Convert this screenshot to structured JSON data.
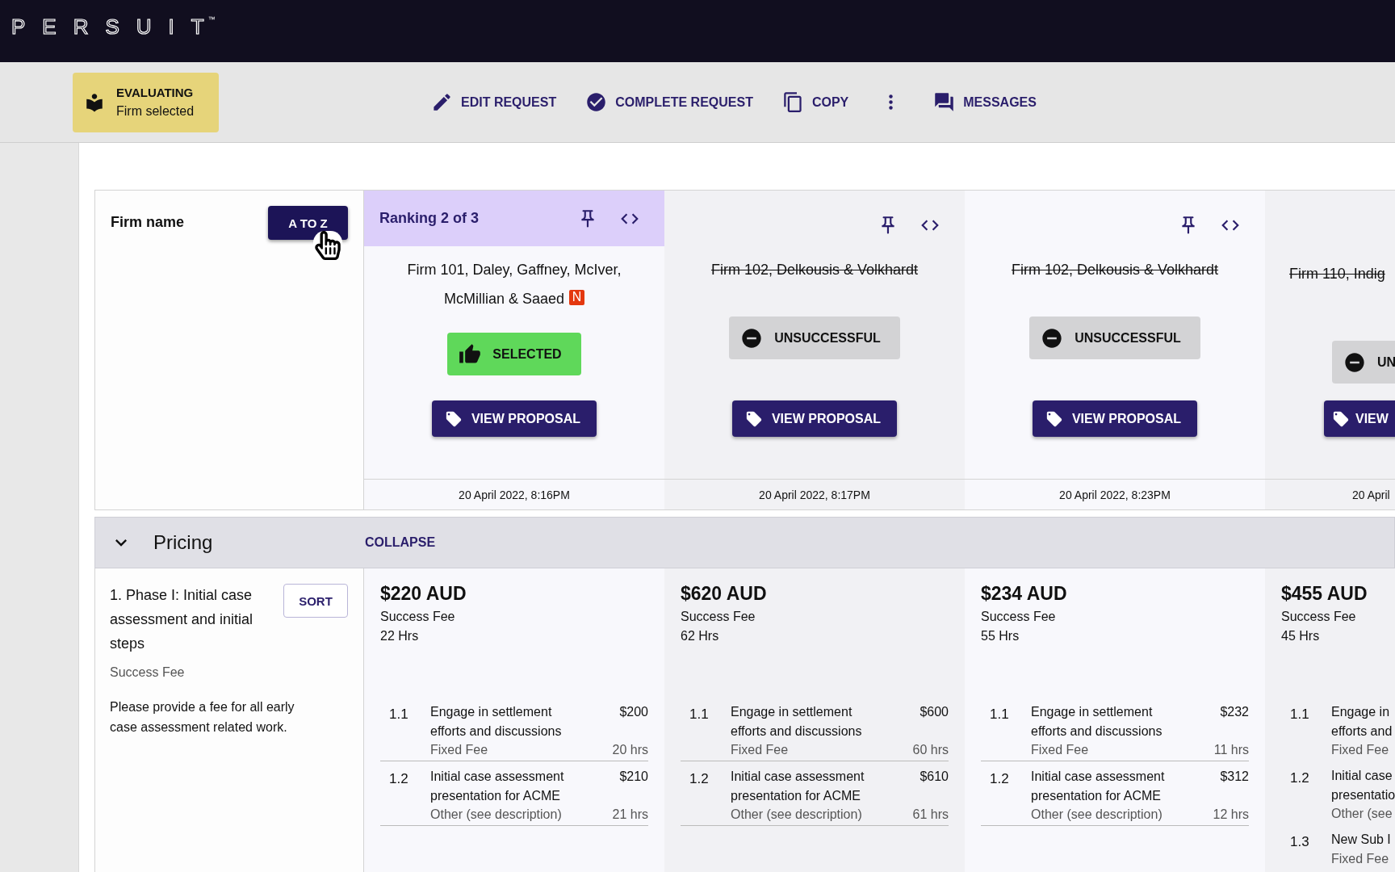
{
  "brand": {
    "logo": "PERSUIT",
    "trademark": "™"
  },
  "status": {
    "title": "EVALUATING",
    "subtitle": "Firm selected"
  },
  "actions": [
    {
      "kind": "edit",
      "label": "EDIT REQUEST"
    },
    {
      "kind": "complete",
      "label": "COMPLETE REQUEST"
    },
    {
      "kind": "copy",
      "label": "COPY"
    },
    {
      "kind": "more"
    },
    {
      "kind": "messages",
      "label": "MESSAGES"
    }
  ],
  "firm_column": {
    "label": "Firm name",
    "sort_button": "A TO Z"
  },
  "firms": [
    {
      "ranking": "Ranking 2 of 3",
      "highlighted": true,
      "name": "Firm 101, Daley, Gaffney, McIver, McMillian & Saaed",
      "badge": "N",
      "struck": false,
      "kind": "selected",
      "outcome_label": "SELECTED",
      "view_label": "VIEW PROPOSAL",
      "date": "20 April 2022, 8:16PM"
    },
    {
      "highlighted": false,
      "name": "Firm 102, Delkousis & Volkhardt",
      "struck": true,
      "kind": "unsuccessful",
      "outcome_label": "UNSUCCESSFUL",
      "view_label": "VIEW PROPOSAL",
      "date": "20 April 2022, 8:17PM"
    },
    {
      "highlighted": false,
      "name": "Firm 102, Delkousis & Volkhardt",
      "struck": true,
      "kind": "unsuccessful",
      "outcome_label": "UNSUCCESSFUL",
      "view_label": "VIEW PROPOSAL",
      "date": "20 April 2022, 8:23PM"
    },
    {
      "highlighted": false,
      "name": "Firm 110, Indig",
      "struck": true,
      "kind": "unsuccessful",
      "outcome_label": "UN",
      "view_label": "VIEW",
      "date": "20 April"
    }
  ],
  "section": {
    "title": "Pricing",
    "expanded": true,
    "toggle": "COLLAPSE"
  },
  "pricing_item": {
    "title": "1. Phase I: Initial case assessment and initial steps",
    "sort_button": "SORT",
    "fee_type": "Success Fee",
    "description": "Please provide a fee for all early case assessment related work."
  },
  "quotes": [
    {
      "total": "$220 AUD",
      "fee_type": "Success Fee",
      "hours": "22 Hrs",
      "lines": [
        {
          "number": "1.1",
          "title": "Engage in settlement efforts and discussions",
          "price": "$200",
          "fee_type": "Fixed Fee",
          "hours": "20 hrs"
        },
        {
          "number": "1.2",
          "title": "Initial case assessment presentation for ACME",
          "price": "$210",
          "fee_type": "Other (see description)",
          "hours": "21 hrs"
        }
      ]
    },
    {
      "total": "$620 AUD",
      "fee_type": "Success Fee",
      "hours": "62 Hrs",
      "lines": [
        {
          "number": "1.1",
          "title": "Engage in settlement efforts and discussions",
          "price": "$600",
          "fee_type": "Fixed Fee",
          "hours": "60 hrs"
        },
        {
          "number": "1.2",
          "title": "Initial case assessment presentation for ACME",
          "price": "$610",
          "fee_type": "Other (see description)",
          "hours": "61 hrs"
        }
      ]
    },
    {
      "total": "$234 AUD",
      "fee_type": "Success Fee",
      "hours": "55 Hrs",
      "lines": [
        {
          "number": "1.1",
          "title": "Engage in settlement efforts and discussions",
          "price": "$232",
          "fee_type": "Fixed Fee",
          "hours": "11 hrs"
        },
        {
          "number": "1.2",
          "title": "Initial case assessment presentation for ACME",
          "price": "$312",
          "fee_type": "Other (see description)",
          "hours": "12 hrs"
        }
      ]
    },
    {
      "total": "$455 AUD",
      "fee_type": "Success Fee",
      "hours": "45 Hrs",
      "lines": [
        {
          "number": "1.1",
          "title": "Engage in efforts and",
          "fee_type": "Fixed Fee"
        },
        {
          "number": "1.2",
          "title": "Initial case presentatio",
          "fee_type": "Other (see"
        },
        {
          "number": "1.3",
          "title": "New Sub I",
          "fee_type": "Fixed Fee"
        }
      ]
    }
  ]
}
